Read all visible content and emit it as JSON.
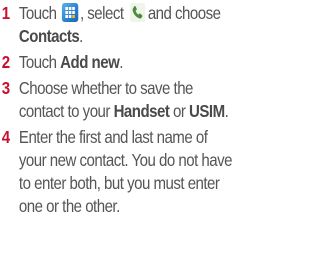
{
  "steps": [
    {
      "number": "1",
      "text_a": "Touch",
      "text_b": ", select",
      "text_c": "and choose",
      "bold_1": "Contacts",
      "text_d": ".",
      "icons": [
        "apps-grid-icon",
        "phone-icon"
      ]
    },
    {
      "number": "2",
      "text_a": "Touch",
      "bold_1": "Add new",
      "text_b": "."
    },
    {
      "number": "3",
      "text_a": "Choose whether to save the",
      "text_b": "contact to your",
      "bold_1": "Handset",
      "text_c": "or",
      "bold_2": "USIM",
      "text_d": "."
    },
    {
      "number": "4",
      "lines": [
        "Enter the first and last name of",
        "your new contact. You do not have",
        "to enter both, but you must enter",
        "one or the other."
      ]
    }
  ],
  "colors": {
    "number": "#c8102e",
    "text": "#555555",
    "apps_icon": "#2b7fd0",
    "phone_icon": "#4a8a3a"
  }
}
